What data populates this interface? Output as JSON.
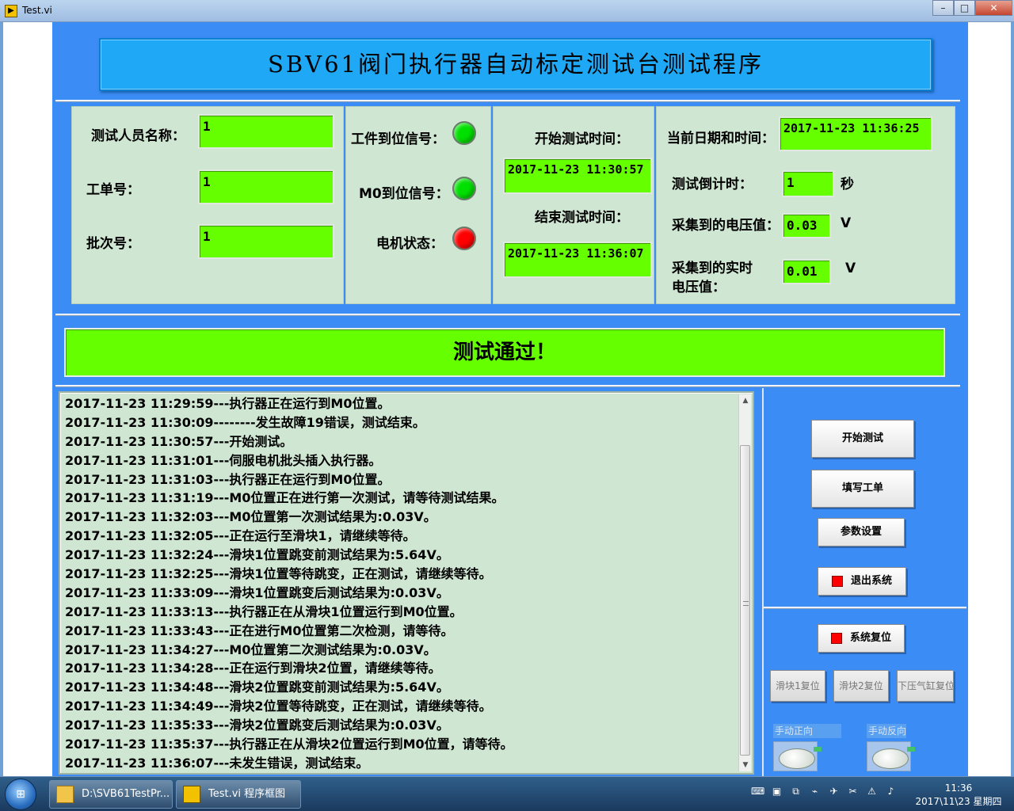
{
  "window": {
    "title": "Test.vi",
    "icon": "labview-vi-icon"
  },
  "header": {
    "title": "SBV61阀门执行器自动标定测试台测试程序"
  },
  "operator_box": {
    "name_label": "测试人员名称：",
    "name_value": "1",
    "order_label": "工单号：",
    "order_value": "1",
    "batch_label": "批次号：",
    "batch_value": "1"
  },
  "signals_box": {
    "workpiece_label": "工件到位信号：",
    "workpiece_color": "#00e000",
    "m0_label": "M0到位信号：",
    "m0_color": "#00e000",
    "motor_label": "电机状态：",
    "motor_color": "#ff0000"
  },
  "time_box": {
    "start_label": "开始测试时间：",
    "start_value": "2017-11-23 11:30:57",
    "end_label": "结束测试时间：",
    "end_value": "2017-11-23 11:36:07"
  },
  "measure_box": {
    "datetime_label": "当前日期和时间：",
    "datetime_value": "2017-11-23 11:36:25",
    "countdown_label": "测试倒计时：",
    "countdown_value": "1",
    "countdown_unit": "秒",
    "voltage_label": "采集到的电压值：",
    "voltage_value": "0.03",
    "voltage_unit": "V",
    "realtime_label_1": "采集到的实时",
    "realtime_label_2": "电压值：",
    "realtime_value": "0.01",
    "realtime_unit": "V"
  },
  "status": {
    "text": "测试通过！",
    "color": "#66ff00"
  },
  "log": [
    "2017-11-23 11:29:59---执行器正在运行到M0位置。",
    "2017-11-23 11:30:09--------发生故障19错误，测试结束。",
    "2017-11-23 11:30:57---开始测试。",
    "2017-11-23 11:31:01---伺服电机批头插入执行器。",
    "2017-11-23 11:31:03---执行器正在运行到M0位置。",
    "2017-11-23 11:31:19---M0位置正在进行第一次测试，请等待测试结果。",
    "2017-11-23 11:32:03---M0位置第一次测试结果为:0.03V。",
    "2017-11-23 11:32:05---正在运行至滑块1，请继续等待。",
    "2017-11-23 11:32:24---滑块1位置跳变前测试结果为:5.64V。",
    "2017-11-23 11:32:25---滑块1位置等待跳变，正在测试，请继续等待。",
    "2017-11-23 11:33:09---滑块1位置跳变后测试结果为:0.03V。",
    "2017-11-23 11:33:13---执行器正在从滑块1位置运行到M0位置。",
    "2017-11-23 11:33:43---正在进行M0位置第二次检测，请等待。",
    "2017-11-23 11:34:27---M0位置第二次测试结果为:0.03V。",
    "2017-11-23 11:34:28---正在运行到滑块2位置，请继续等待。",
    "2017-11-23 11:34:48---滑块2位置跳变前测试结果为:5.64V。",
    "2017-11-23 11:34:49---滑块2位置等待跳变，正在测试，请继续等待。",
    "2017-11-23 11:35:33---滑块2位置跳变后测试结果为:0.03V。",
    "2017-11-23 11:35:37---执行器正在从滑块2位置运行到M0位置，请等待。",
    "2017-11-23 11:36:07---未发生错误，测试结束。"
  ],
  "controls": {
    "start_test": "开始测试",
    "fill_order": "填写工单",
    "params": "参数设置",
    "exit": "退出系统",
    "reset": "系统复位",
    "slider1_reset": "滑块1复位",
    "slider2_reset": "滑块2复位",
    "cylinder_reset": "下压气缸复位",
    "manual_forward": "手动正向",
    "manual_reverse": "手动反向"
  },
  "taskbar": {
    "folder_item": "D:\\SVB61TestPr...",
    "vi_item": "Test.vi 程序框图",
    "time": "11:36",
    "date": "2017\\11\\23 星期四"
  }
}
